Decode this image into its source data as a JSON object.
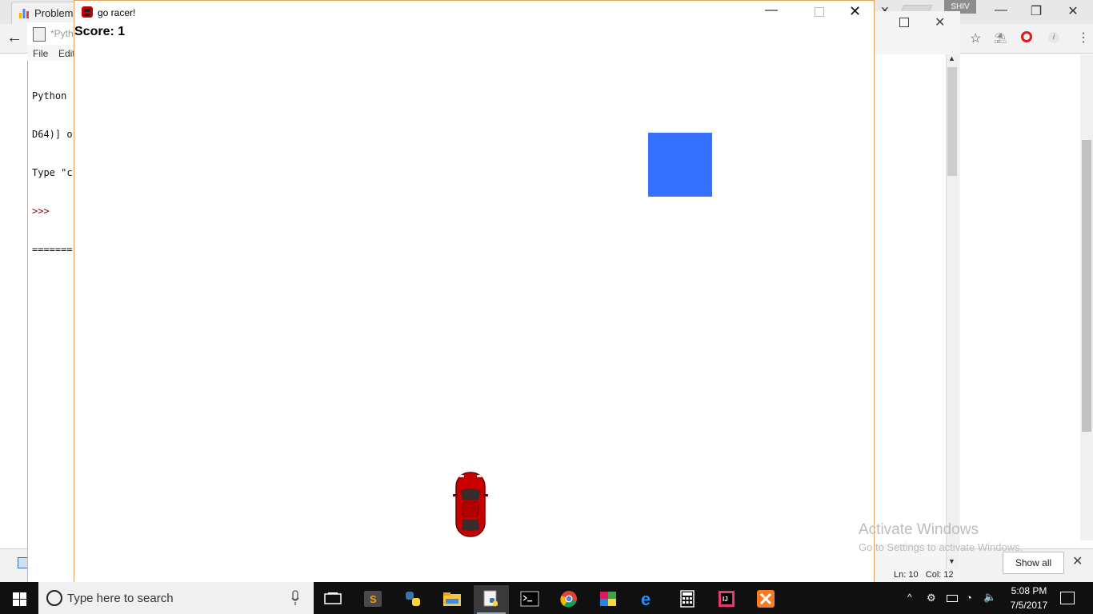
{
  "browser": {
    "tab_title": "Problem",
    "profile_name": "SHIV",
    "show_all_label": "Show all"
  },
  "idle_editor": {
    "status_line": "Ln: 10   Col: 12"
  },
  "python_shell": {
    "title": "*Pyth",
    "menu": [
      "File",
      "Edit"
    ],
    "lines": [
      "Python",
      "D64)] o",
      "Type \"c",
      ">>>",
      "======="
    ]
  },
  "game_window": {
    "title": "go racer!",
    "score_label": "Score: ",
    "score_value": "1",
    "block_color": "#3471ff",
    "car_color": "#c80000"
  },
  "watermark": {
    "title": "Activate Windows",
    "subtitle": "Go to Settings to activate Windows."
  },
  "taskbar": {
    "search_placeholder": "Type here to search",
    "apps": [
      "task-view",
      "sublime-text",
      "python",
      "file-explorer",
      "python-idle",
      "command-prompt",
      "chrome",
      "winrar",
      "edge",
      "calculator",
      "intellij",
      "xampp"
    ],
    "clock_time": "5:08 PM",
    "clock_date": "7/5/2017"
  }
}
